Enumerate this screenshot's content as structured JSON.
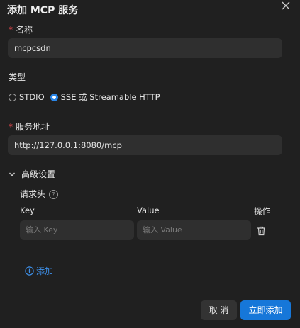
{
  "dialog": {
    "title": "添加 MCP 服务",
    "close_icon": "close-icon"
  },
  "form": {
    "required_mark": "*",
    "name_label": "名称",
    "name_value": "mcpcsdn",
    "type_label": "类型",
    "type_options": [
      {
        "label": "STDIO",
        "checked": false
      },
      {
        "label": "SSE 或 Streamable HTTP",
        "checked": true
      }
    ],
    "address_label": "服务地址",
    "address_value": "http://127.0.0.1:8080/mcp"
  },
  "advanced": {
    "label": "高级设置",
    "expanded": true,
    "headers_label": "请求头",
    "help_glyph": "?",
    "columns": {
      "key": "Key",
      "value": "Value",
      "actions": "操作"
    },
    "row": {
      "key_placeholder": "输入 Key",
      "value_placeholder": "输入 Value"
    },
    "add_label": "添加"
  },
  "footer": {
    "cancel_label": "取 消",
    "submit_label": "立即添加"
  },
  "colors": {
    "background": "#202020",
    "input_bg": "#2f2f2f",
    "accent": "#1677d9",
    "link": "#3d8fe8",
    "required": "#e5484d"
  }
}
